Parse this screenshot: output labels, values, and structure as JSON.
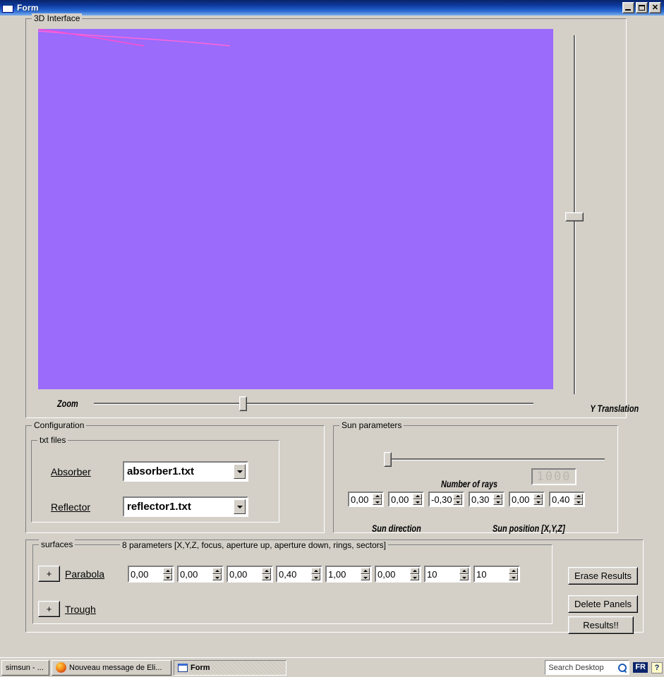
{
  "window": {
    "title": "Form",
    "minimize_label": "_",
    "maximize_label": "",
    "close_label": "✕"
  },
  "viewport": {
    "legend": "3D Interface",
    "background_color": "#9b6bfb",
    "ray_color": "#ff66d9"
  },
  "zoom_slider": {
    "label": "Zoom"
  },
  "y_translation_slider": {
    "label": "Y Translation"
  },
  "configuration": {
    "legend": "Configuration",
    "txt_files": {
      "legend": "txt files",
      "absorber_label": "Absorber",
      "absorber_value": "absorber1.txt",
      "reflector_label": "Reflector",
      "reflector_value": "reflector1.txt"
    }
  },
  "sun_parameters": {
    "legend": "Sun parameters",
    "number_of_rays_label": "Number of rays",
    "number_of_rays_value": "1000",
    "sun_direction_label": "Sun direction",
    "sun_position_label": "Sun position [X,Y,Z]",
    "direction_values": [
      "0,00",
      "0,00",
      "-0,30"
    ],
    "position_values": [
      "0,30",
      "0,00",
      "0,40"
    ]
  },
  "surfaces": {
    "legend": "surfaces",
    "parameters_hint": "8 parameters [X,Y,Z, focus, aperture up, aperture down, rings, sectors]",
    "rows": [
      {
        "add_label": "+",
        "name": "Parabola",
        "values": [
          "0,00",
          "0,00",
          "0,00",
          "0,40",
          "1,00",
          "0,00",
          "10",
          "10"
        ]
      },
      {
        "add_label": "+",
        "name": "Trough",
        "values": []
      }
    ]
  },
  "actions": {
    "erase_results": "Erase Results",
    "delete_panels": "Delete Panels",
    "results": "Results!!"
  },
  "taskbar": {
    "tasks": [
      {
        "label": "simsun - ...",
        "icon": "none",
        "active": false
      },
      {
        "label": "Nouveau message de Eli...",
        "icon": "firefox-icon",
        "active": false
      },
      {
        "label": "Form",
        "icon": "form-window-icon",
        "active": true
      }
    ],
    "search_placeholder": "Search Desktop",
    "language_indicator": "FR",
    "help_indicator": "?"
  }
}
